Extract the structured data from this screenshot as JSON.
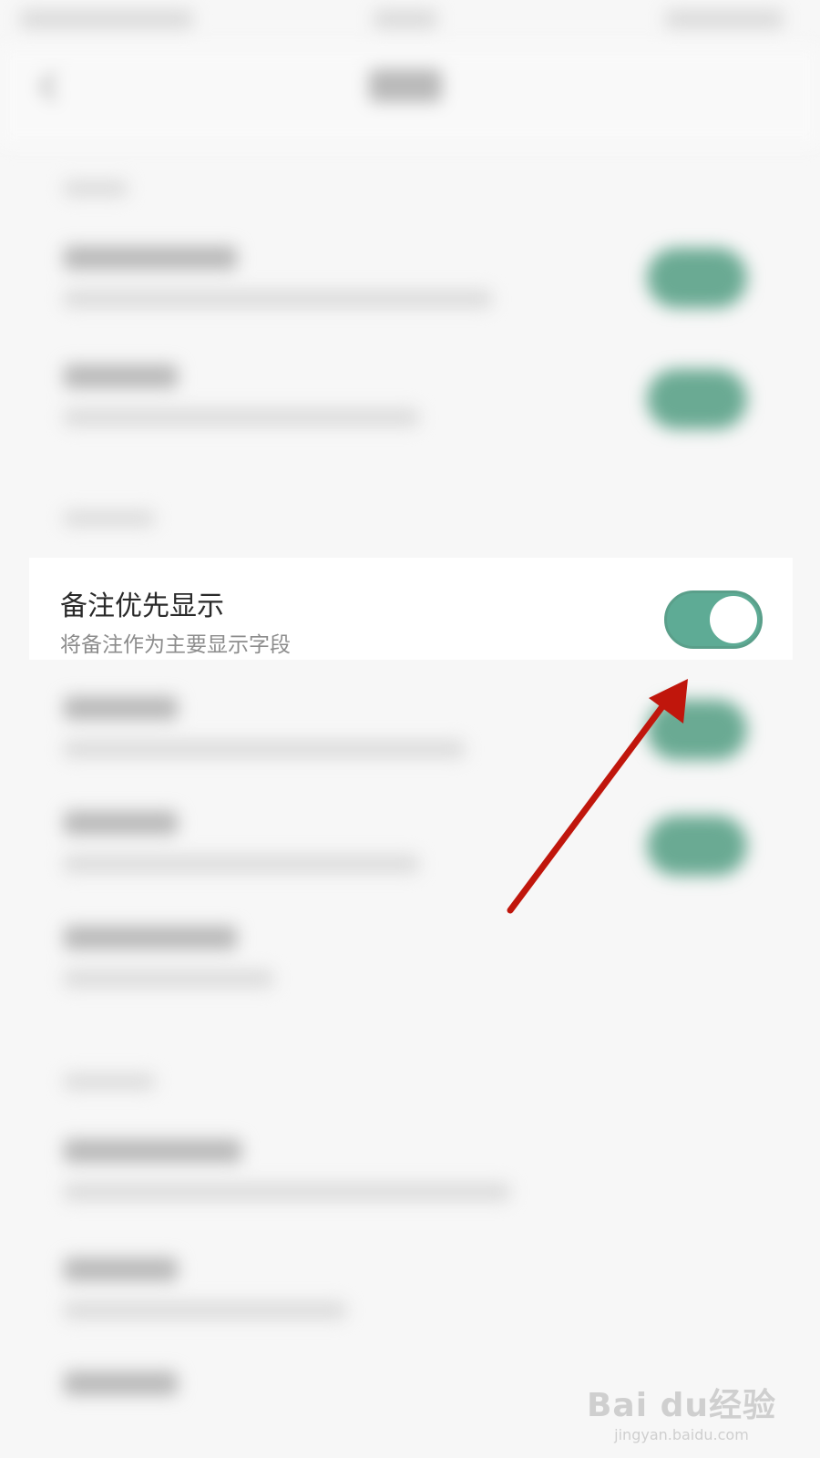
{
  "setting": {
    "title": "备注优先显示",
    "subtitle": "将备注作为主要显示字段",
    "toggle_on": true,
    "accent": "#5eab95"
  },
  "annotation": {
    "arrow_color": "#c0160c"
  },
  "watermark": {
    "logo": "Bai du经验",
    "url": "jingyan.baidu.com"
  },
  "icons": {
    "back": "chevron-left-icon",
    "paw": "baidu-paw-icon"
  }
}
